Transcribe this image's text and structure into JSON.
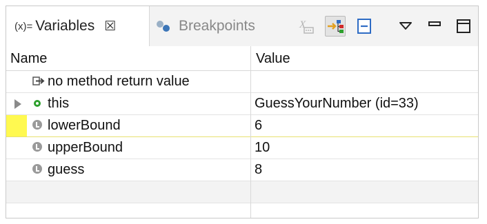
{
  "tabs": {
    "variables": {
      "prefix": "(x)=",
      "label": "Variables",
      "close": "☒"
    },
    "breakpoints": {
      "label": "Breakpoints"
    }
  },
  "toolbar": {
    "items": [
      "show-type-names-icon",
      "collapse-all-icon",
      "view-menu-icon",
      "minimize-icon",
      "maximize-icon"
    ]
  },
  "table": {
    "columns": [
      "Name",
      "Value"
    ],
    "rows": [
      {
        "name": "no method return value",
        "value": "",
        "icon": "return-value-icon"
      },
      {
        "name": "this",
        "value": "GuessYourNumber  (id=33)",
        "icon": "field-icon",
        "expandable": true
      },
      {
        "name": "lowerBound",
        "value": "6",
        "icon": "local-variable-icon",
        "highlighted": true
      },
      {
        "name": "upperBound",
        "value": "10",
        "icon": "local-variable-icon"
      },
      {
        "name": "guess",
        "value": "8",
        "icon": "local-variable-icon"
      },
      {
        "name": "",
        "value": ""
      },
      {
        "name": "",
        "value": ""
      }
    ]
  },
  "colors": {
    "highlight": "#fff950",
    "tab_bg": "#f3f3f3",
    "field_icon": "#2da02d"
  }
}
